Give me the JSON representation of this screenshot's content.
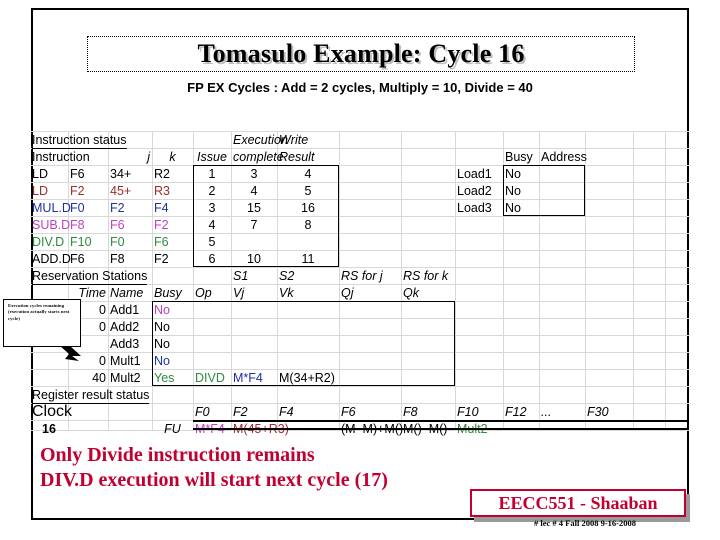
{
  "slide": {
    "title": "Tomasulo Example:  Cycle 16",
    "subtitle": "FP EX Cycles :  Add = 2 cycles, Multiply = 10, Divide = 40",
    "note_line1": "Only Divide instruction remains",
    "note_line2": "DIV.D execution will start next cycle (17)",
    "badge": "EECC551 - Shaaban",
    "footer": "#  lec # 4  Fall 2008    9-16-2008",
    "callout": "Execution cycles remaining (execution actually starts next cycle)",
    "accent_red": "#c20030"
  },
  "instruction_status": {
    "section_label": "Instruction status",
    "headers": {
      "instruction": "Instruction",
      "j": "j",
      "k": "k",
      "issue": "Issue",
      "execution": "Execution",
      "complete": "complete",
      "write": "Write",
      "result": "Result"
    },
    "rows": [
      {
        "op": "LD",
        "j": "F6",
        "k2": "34+",
        "k": "R2",
        "issue": "1",
        "complete": "3",
        "write": "4",
        "color": "#000000"
      },
      {
        "op": "LD",
        "j": "F2",
        "k2": "45+",
        "k": "R3",
        "issue": "2",
        "complete": "4",
        "write": "5",
        "color": "#a02c2c"
      },
      {
        "op": "MUL.D",
        "j": "F0",
        "k2": "F2",
        "k": "F4",
        "issue": "3",
        "complete": "15",
        "write": "16",
        "color": "#2030a0"
      },
      {
        "op": "SUB.D",
        "j": "F8",
        "k2": "F6",
        "k": "F2",
        "issue": "4",
        "complete": "7",
        "write": "8",
        "color": "#c040c0"
      },
      {
        "op": "DIV.D",
        "j": "F10",
        "k2": "F0",
        "k": "F6",
        "issue": "5",
        "complete": "",
        "write": "",
        "color": "#2e8b3d"
      },
      {
        "op": "ADD.D",
        "j": "F6",
        "k2": "F8",
        "k": "F2",
        "issue": "6",
        "complete": "10",
        "write": "11",
        "color": "#000000"
      }
    ]
  },
  "load_buffers": {
    "headers": {
      "busy": "Busy",
      "address": "Address"
    },
    "rows": [
      {
        "name": "Load1",
        "busy": "No",
        "address": ""
      },
      {
        "name": "Load2",
        "busy": "No",
        "address": ""
      },
      {
        "name": "Load3",
        "busy": "No",
        "address": ""
      }
    ]
  },
  "reservation_stations": {
    "section_label": "Reservation Stations",
    "headers": {
      "time": "Time",
      "name": "Name",
      "busy": "Busy",
      "op": "Op",
      "s1": "S1",
      "vj": "Vj",
      "s2": "S2",
      "vk": "Vk",
      "rs_for_j": "RS for j",
      "qj": "Qj",
      "rs_for_k": "RS for k",
      "qk": "Qk"
    },
    "rows": [
      {
        "time": "0",
        "name": "Add1",
        "busy": "No",
        "busy_color": "#c040c0",
        "op": "",
        "vj": "",
        "vk": "",
        "qj": "",
        "qk": "",
        "op_color": "#000000",
        "v_color": "#000000"
      },
      {
        "time": "0",
        "name": "Add2",
        "busy": "No",
        "busy_color": "#000000",
        "op": "",
        "vj": "",
        "vk": "",
        "qj": "",
        "qk": "",
        "op_color": "#000000",
        "v_color": "#000000"
      },
      {
        "time": "",
        "name": "Add3",
        "busy": "No",
        "busy_color": "#000000",
        "op": "",
        "vj": "",
        "vk": "",
        "qj": "",
        "qk": "",
        "op_color": "#000000",
        "v_color": "#000000"
      },
      {
        "time": "0",
        "name": "Mult1",
        "busy": "No",
        "busy_color": "#2030a0",
        "op": "",
        "vj": "",
        "vk": "",
        "qj": "",
        "qk": "",
        "op_color": "#000000",
        "v_color": "#000000"
      },
      {
        "time": "40",
        "name": "Mult2",
        "busy": "Yes",
        "busy_color": "#2e8b3d",
        "op": "DIVD",
        "vj": "M*F4",
        "vk": "M(34+R2)",
        "qj": "",
        "qk": "",
        "op_color": "#2e8b3d",
        "v_color": "#2030a0"
      }
    ]
  },
  "register_result_status": {
    "section_label": "Register result status",
    "clock_label": "Clock",
    "clock_value": "16",
    "fu_label": "FU",
    "registers": [
      "F0",
      "F2",
      "F4",
      "F6",
      "F8",
      "F10",
      "F12",
      "...",
      "F30"
    ],
    "values": [
      "M*F4",
      "M(45+R3)",
      "",
      "(M–M)+M()",
      "M()–M()",
      "Mult2",
      "",
      "",
      ""
    ],
    "value_colors": [
      "#c040c0",
      "#a02c2c",
      "#000000",
      "#000000",
      "#000000",
      "#2e8b3d",
      "#000000",
      "#000000",
      "#000000"
    ]
  }
}
